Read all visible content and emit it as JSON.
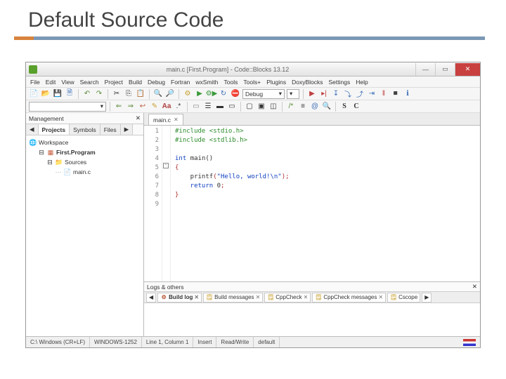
{
  "slide": {
    "title": "Default Source Code"
  },
  "window": {
    "title": "main.c [First.Program] - Code::Blocks 13.12",
    "minimize": "—",
    "maximize": "▭",
    "close": "✕"
  },
  "menu": [
    "File",
    "Edit",
    "View",
    "Search",
    "Project",
    "Build",
    "Debug",
    "Fortran",
    "wxSmith",
    "Tools",
    "Tools+",
    "Plugins",
    "DoxyBlocks",
    "Settings",
    "Help"
  ],
  "toolbar1": {
    "build_target": "Debug",
    "icons": [
      "new",
      "open",
      "save",
      "save-all",
      "undo",
      "redo",
      "cut",
      "copy",
      "paste",
      "find",
      "replace",
      "build",
      "run",
      "build-run",
      "rebuild",
      "stop",
      "target"
    ],
    "icons2": [
      "debug-start",
      "debug-run-cursor",
      "debug-step",
      "debug-step-in",
      "debug-step-out",
      "debug-stop",
      "debug-info",
      "debug-window"
    ]
  },
  "toolbar2": {
    "combo": "",
    "icons": [
      "nav-back",
      "nav-fwd",
      "nav-last",
      "highlight",
      "text-color",
      "toggle",
      "bookmark",
      "bookmark-prev",
      "bookmark-next",
      "block",
      "frame-full",
      "frame-half",
      "frame-min",
      "comment",
      "doc",
      "at",
      "search",
      "letter-s",
      "letter-c"
    ]
  },
  "management": {
    "title": "Management",
    "close": "✕",
    "nav_prev": "◀",
    "nav_next": "▶",
    "tabs": [
      "Projects",
      "Symbols",
      "Files"
    ],
    "active_tab": 0,
    "tree": {
      "workspace": "Workspace",
      "project": "First.Program",
      "sources": "Sources",
      "file": "main.c"
    }
  },
  "editor": {
    "tabs": [
      {
        "label": "main.c"
      }
    ],
    "line_numbers": [
      "1",
      "2",
      "3",
      "4",
      "5",
      "6",
      "7",
      "8",
      "9"
    ],
    "code": {
      "l1_a": "#include ",
      "l1_b": "<stdio.h>",
      "l2_a": "#include ",
      "l2_b": "<stdlib.h>",
      "l3": "",
      "l4_a": "int ",
      "l4_b": "main",
      "l4_c": "()",
      "l5": "{",
      "l6_a": "    printf",
      "l6_b": "(",
      "l6_c": "\"Hello, world!\\n\"",
      "l6_d": ");",
      "l7_a": "    return ",
      "l7_b": "0",
      "l7_c": ";",
      "l8": "}",
      "l9": ""
    }
  },
  "logs": {
    "title": "Logs & others",
    "close": "✕",
    "nav_prev": "◀",
    "nav_next": "▶",
    "tabs": [
      "Build log",
      "Build messages",
      "CppCheck",
      "CppCheck messages",
      "Cscope"
    ],
    "active_tab": 0
  },
  "statusbar": {
    "path": "C:\\ Windows (CR+LF)",
    "encoding": "WINDOWS-1252",
    "position": "Line 1, Column 1",
    "mode": "Insert",
    "rw": "Read/Write",
    "profile": "default"
  }
}
